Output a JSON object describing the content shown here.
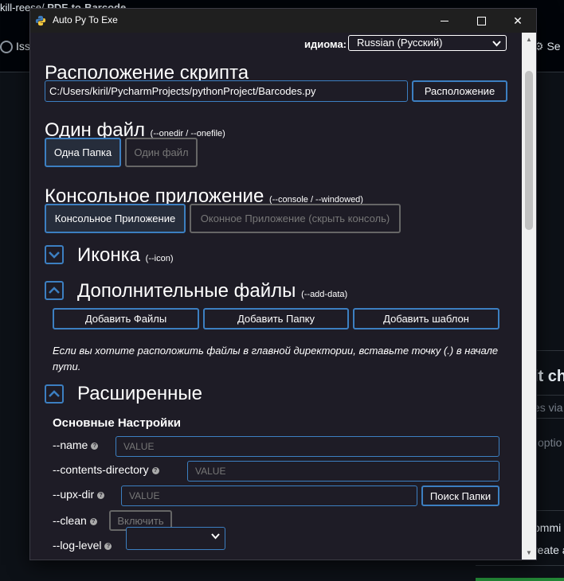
{
  "background_app": {
    "repo_path": "kill-reese/",
    "repo_name": "PDF-to-Barcode",
    "issues_tab": "Issu",
    "settings_tab": "Se",
    "commit_title": "it ch",
    "commit_input": "es via c",
    "commit_option": "optio",
    "radio_commit": "ommi",
    "radio_create": "reate a"
  },
  "window": {
    "title": "Auto Py To Exe",
    "minimize": "minimize",
    "maximize": "maximize",
    "close": "✕"
  },
  "language": {
    "label": "идиома:",
    "selected": "Russian (Русский)"
  },
  "script_location": {
    "heading": "Расположение скрипта",
    "path_value": "C:/Users/kiril/PycharmProjects/pythonProject/Barcodes.py",
    "browse_button": "Расположение"
  },
  "onefile": {
    "heading": "Один файл",
    "hint": "(--onedir / --onefile)",
    "option_onedir": "Одна Папка",
    "option_onefile": "Один файл",
    "selected": "Одна Папка"
  },
  "console": {
    "heading": "Консольное приложение",
    "hint": "(--console / --windowed)",
    "option_console": "Консольное Приложение",
    "option_windowed": "Оконное Приложение (скрыть консоль)",
    "selected": "Консольное Приложение"
  },
  "icon_section": {
    "heading": "Иконка",
    "hint": "(--icon)",
    "expanded": false
  },
  "additional_files": {
    "heading": "Дополнительные файлы",
    "hint": "(--add-data)",
    "expanded": true,
    "add_files_button": "Добавить Файлы",
    "add_folder_button": "Добавить Папку",
    "add_blank_button": "Добавить шаблон",
    "note": "Если вы хотите расположить файлы в главной директории, вставьте точку (.) в начале пути."
  },
  "advanced": {
    "heading": "Расширенные",
    "expanded": true,
    "subheading": "Основные Настройки",
    "options": {
      "name": {
        "label": "--name",
        "placeholder": "VALUE"
      },
      "contents_directory": {
        "label": "--contents-directory",
        "placeholder": "VALUE"
      },
      "upx_dir": {
        "label": "--upx-dir",
        "placeholder": "VALUE",
        "button": "Поиск Папки"
      },
      "clean": {
        "label": "--clean",
        "button": "Включить"
      },
      "log_level": {
        "label": "--log-level",
        "selected": ""
      }
    }
  },
  "colors": {
    "window_bg": "#1e1c26",
    "accent_border": "#3c7fc1",
    "disabled_border": "#666666"
  }
}
